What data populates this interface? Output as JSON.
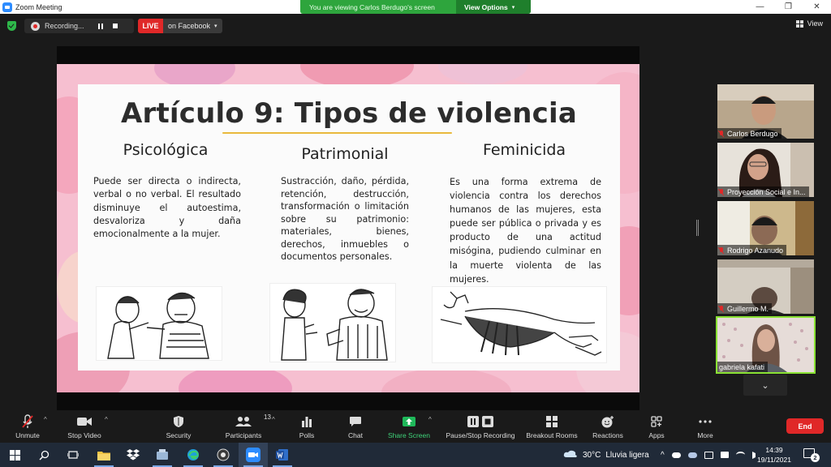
{
  "window": {
    "title": "Zoom Meeting",
    "minimize_glyph": "—",
    "restore_glyph": "❐",
    "close_glyph": "✕"
  },
  "banner": {
    "viewing_text": "You are viewing Carlos Berdugo's screen",
    "view_options_label": "View Options",
    "chevron_glyph": "▾"
  },
  "meeting_bar": {
    "recording_label": "Recording...",
    "live_label": "LIVE",
    "live_destination": "on Facebook",
    "live_chevron": "▾",
    "view_label": "View"
  },
  "slide": {
    "title": "Artículo 9: Tipos de violencia",
    "columns": [
      {
        "heading": "Psicológica",
        "text": "Puede ser directa o indirecta, verbal o no verbal. El resultado disminuye el autoestima, desvaloriza y daña emocionalmente a la mujer."
      },
      {
        "heading": "Patrimonial",
        "text": "Sustracción, daño, pérdida, retención, destrucción, transformación o limitación sobre su patrimonio: materiales, bienes, derechos, inmuebles o documentos personales."
      },
      {
        "heading": "Feminicida",
        "text": "Es una forma extrema de violencia contra los derechos humanos de las mujeres, esta puede ser pública o privada y es producto de una actitud misógina, pudiendo culminar en la muerte violenta de las mujeres."
      }
    ],
    "colors": {
      "background_pink": "#f6bfd0",
      "card": "#fbfbfb",
      "underline": "#e9b93c"
    }
  },
  "participants": [
    {
      "name": "Carlos Berdugo",
      "muted": true,
      "bg": "#b9aa92",
      "active": false
    },
    {
      "name": "Proyección Social e In...",
      "muted": true,
      "bg": "#e7e2da",
      "active": false
    },
    {
      "name": "Rodrigo Azanudo",
      "muted": true,
      "bg": "#c6b07e",
      "active": false
    },
    {
      "name": "Guillermo M.",
      "muted": true,
      "bg": "#cfc7bb",
      "active": false
    },
    {
      "name": "gabriela kafati",
      "muted": false,
      "bg": "#e4d8d4",
      "active": true
    }
  ],
  "participants_scroll_glyph": "⌄",
  "toolbar": {
    "unmute": "Unmute",
    "stop_video": "Stop Video",
    "security": "Security",
    "participants": "Participants",
    "participants_count": "13",
    "polls": "Polls",
    "chat": "Chat",
    "share_screen": "Share Screen",
    "pause_stop_recording": "Pause/Stop Recording",
    "breakout_rooms": "Breakout Rooms",
    "reactions": "Reactions",
    "apps": "Apps",
    "more": "More",
    "end": "End",
    "caret_glyph": "^"
  },
  "taskbar": {
    "weather_temp": "30°C",
    "weather_desc": "Lluvia ligera",
    "time": "14:39",
    "date": "19/11/2021",
    "notification_count": "2",
    "tray_chevron": "^"
  },
  "accent_colors": {
    "zoom_blue": "#2d8cff",
    "banner_green": "#2ea53d",
    "live_red": "#e02828",
    "share_green": "#1fb85a",
    "active_speaker": "#8ae234"
  }
}
